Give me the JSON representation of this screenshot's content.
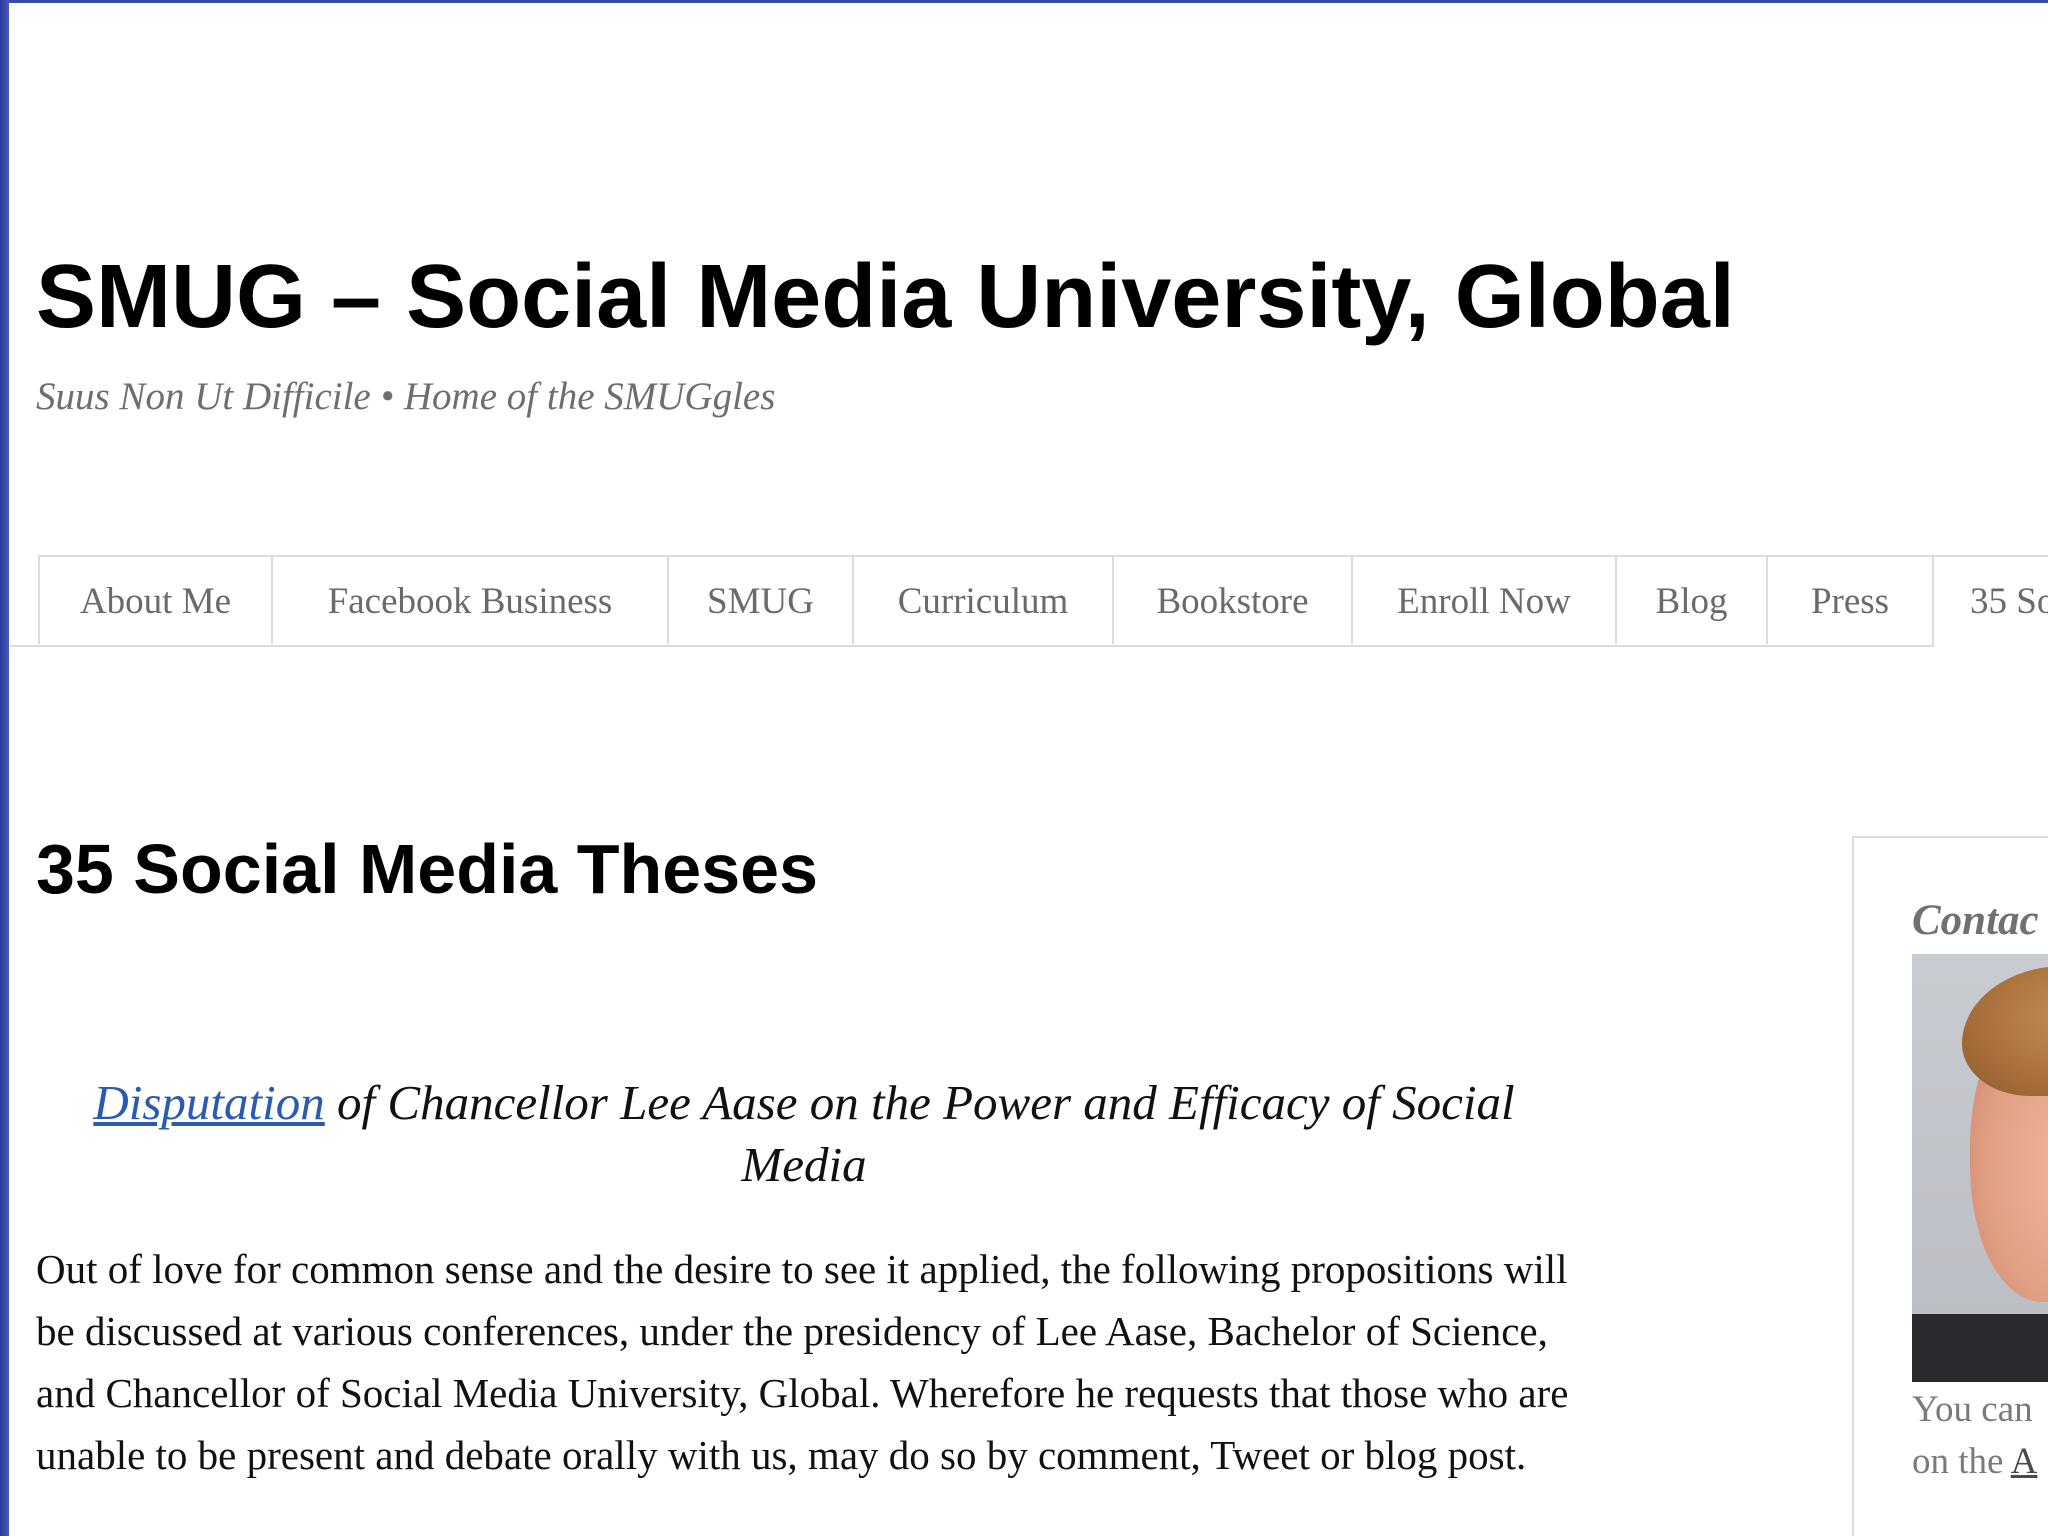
{
  "header": {
    "title": "SMUG – Social Media University, Global",
    "tagline": "Suus Non Ut Difficile • Home of the SMUGgles"
  },
  "nav": {
    "tabs": [
      {
        "label": "About Me"
      },
      {
        "label": "Facebook Business"
      },
      {
        "label": "SMUG"
      },
      {
        "label": "Curriculum"
      },
      {
        "label": "Bookstore"
      },
      {
        "label": "Enroll Now"
      },
      {
        "label": "Blog"
      },
      {
        "label": "Press"
      },
      {
        "label": "35 So"
      }
    ]
  },
  "main": {
    "heading": "35 Social Media Theses",
    "disputation_link": "Disputation",
    "disputation_rest": " of Chancellor Lee Aase on the Power and Efficacy of Social Media",
    "paragraph": "Out of love for common sense and the desire to see it applied, the following propositions will be discussed at various conferences, under the presidency of Lee Aase, Bachelor of Science, and Chancellor of Social Media University, Global. Wherefore he requests that those who are unable to be present and debate orally with us, may do so by comment, Tweet or blog post."
  },
  "sidebar": {
    "heading": "Contac",
    "text_line1": "You can",
    "text_line2_prefix": "on the ",
    "text_line2_link": "A"
  }
}
